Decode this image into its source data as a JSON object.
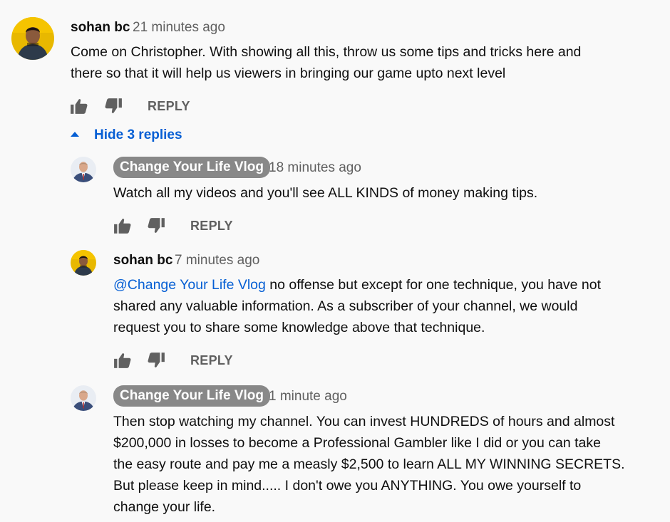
{
  "comment": {
    "author": "sohan bc",
    "time": "21 minutes ago",
    "text_lines": [
      "Come on Christopher. With showing all this, throw us some tips and tricks here and",
      "there so that it will help us viewers in bringing our game upto next level"
    ],
    "reply_label": "REPLY",
    "hide_replies_label": "Hide 3 replies"
  },
  "replies": [
    {
      "author": "Change Your Life Vlog",
      "time": "18 minutes ago",
      "text_lines": [
        "Watch all my videos and you'll see ALL KINDS of money making tips."
      ],
      "reply_label": "REPLY"
    },
    {
      "author": "sohan bc",
      "time": "7 minutes ago",
      "mention": "@Change Your Life Vlog",
      "text_first_rest": " no offense but except for one technique, you have not",
      "text_lines": [
        "shared any valuable information. As a subscriber of your channel, we would",
        "request you to share some knowledge above that technique."
      ],
      "reply_label": "REPLY"
    },
    {
      "author": "Change Your Life Vlog",
      "time": "1 minute ago",
      "text_lines": [
        "Then stop watching my channel. You can invest HUNDREDS of hours and almost",
        "$200,000 in losses to become a Professional Gambler like I did or you can take",
        "the easy route and pay me a measly $2,500 to learn ALL MY WINNING SECRETS.",
        "But please keep in mind..... I don't owe you ANYTHING. You owe yourself to",
        "change your life."
      ]
    }
  ],
  "icons": {
    "like": "thumbs-up-icon",
    "dislike": "thumbs-down-icon",
    "caret": "caret-up-icon"
  },
  "colors": {
    "link": "#065fd4",
    "chip": "#888888",
    "muted": "#606060",
    "background": "#f9f9f9"
  }
}
